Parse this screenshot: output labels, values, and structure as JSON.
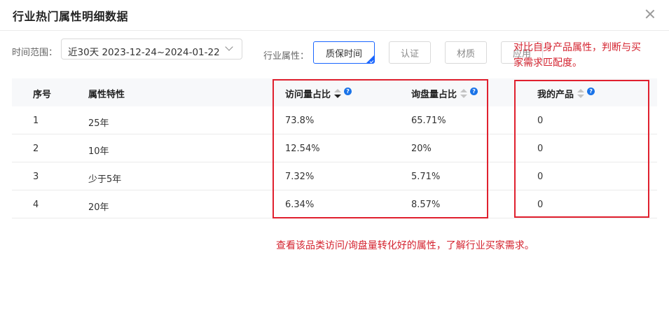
{
  "dialog": {
    "title": "行业热门属性明细数据"
  },
  "filters": {
    "time_label": "时间范围：",
    "time_value": "近30天 2023-12-24~2024-01-22",
    "attr_label": "行业属性：",
    "attr_options": [
      {
        "label": "质保时间",
        "active": true
      },
      {
        "label": "认证",
        "active": false
      },
      {
        "label": "材质",
        "active": false
      },
      {
        "label": "应用",
        "active": false
      }
    ]
  },
  "table": {
    "headers": {
      "index": "序号",
      "attr": "属性特性",
      "visit": "访问量占比",
      "inquiry": "询盘量占比",
      "mine": "我的产品"
    },
    "help_glyph": "?",
    "rows": [
      {
        "index": "1",
        "attr": "25年",
        "visit": "73.8%",
        "inquiry": "65.71%",
        "mine": "0"
      },
      {
        "index": "2",
        "attr": "10年",
        "visit": "12.54%",
        "inquiry": "20%",
        "mine": "0"
      },
      {
        "index": "3",
        "attr": "少于5年",
        "visit": "7.32%",
        "inquiry": "5.71%",
        "mine": "0"
      },
      {
        "index": "4",
        "attr": "20年",
        "visit": "6.34%",
        "inquiry": "8.57%",
        "mine": "0"
      }
    ]
  },
  "annotations": {
    "compare_note_line1": "对比自身产品属性，判断与买",
    "compare_note_line2": "家需求匹配度。",
    "view_note": "查看该品类访问/询盘量转化好的属性，了解行业买家需求。",
    "color": "#e0202e"
  }
}
